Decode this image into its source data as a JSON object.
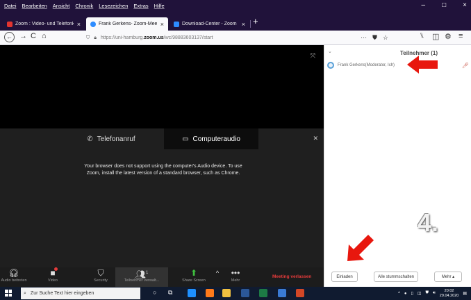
{
  "menubar": {
    "items": [
      "Datei",
      "Bearbeiten",
      "Ansicht",
      "Chronik",
      "Lesezeichen",
      "Extras",
      "Hilfe"
    ],
    "window_controls": [
      "–",
      "□",
      "×"
    ]
  },
  "tabs": [
    {
      "label": "Zoom : Video- und Telefonkon",
      "color": "#e3342f"
    },
    {
      "label": "Frank Gerkens- Zoom-Meeting",
      "color": "#2d8cff"
    },
    {
      "label": "Download-Center - Zoom",
      "color": "#2d8cff"
    }
  ],
  "address": {
    "prefix": "https://uni-hamburg.",
    "host": "zoom.us",
    "path": "/wc/98883603137/start"
  },
  "audio_dialog": {
    "tab_phone": "Telefonanruf",
    "tab_computer": "Computeraudio",
    "message": "Your browser does not support using the computer's Audio device. To use Zoom, install the latest version of a standard browser, such as Chrome."
  },
  "toolbar": {
    "audio": "Audio beitreten",
    "video": "Video",
    "security": "Security",
    "participants": "Teilnehmer verwalt...",
    "participants_count": "1",
    "share": "Share Screen",
    "more": "Mehr",
    "leave": "Meeting verlassen"
  },
  "participants_panel": {
    "title": "Teilnehmer (1)",
    "participant_name": "Frank Gerkens(Moderator, Ich)",
    "invite": "Einladen",
    "mute_all": "Alle stummschalten",
    "more": "Mehr ▴"
  },
  "annotation": {
    "step": "4."
  },
  "taskbar": {
    "search_placeholder": "Zur Suche Text hier eingeben",
    "time": "20:02",
    "date": "29.04.2020"
  },
  "colors": {
    "accent_red": "#e8170e",
    "zoom_blue": "#2d8cff",
    "leave_red": "#e53b3b"
  }
}
